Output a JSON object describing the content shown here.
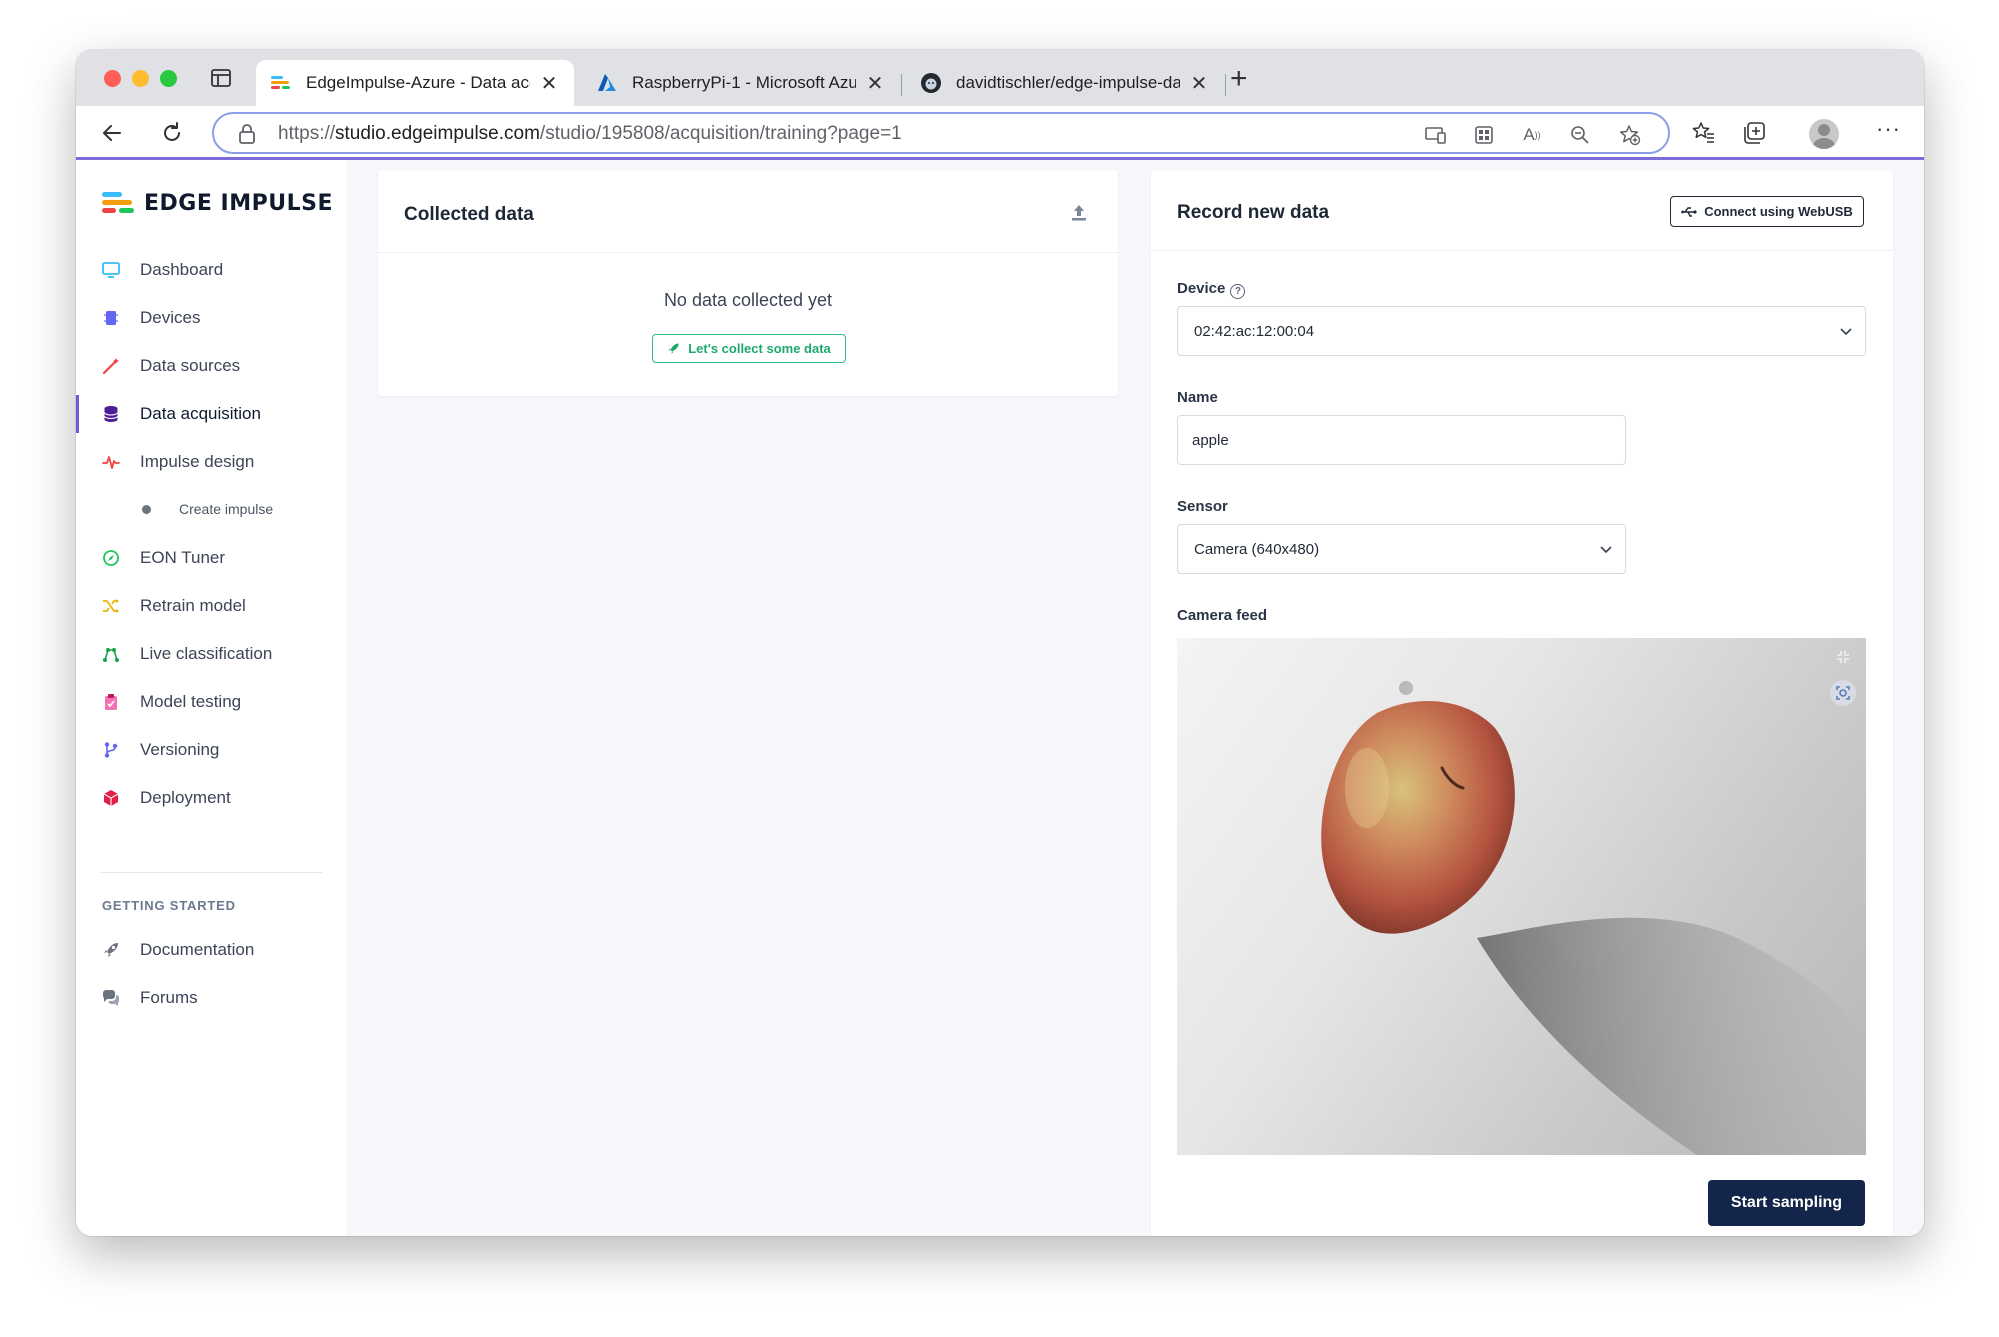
{
  "browser": {
    "tabs": [
      {
        "title": "EdgeImpulse-Azure - Data acq",
        "icon": "edge-impulse-favicon",
        "active": true
      },
      {
        "title": "RaspberryPi-1 - Microsoft Azur",
        "icon": "azure-favicon",
        "active": false
      },
      {
        "title": "davidtischler/edge-impulse-da",
        "icon": "github-favicon",
        "active": false
      }
    ],
    "url_scheme": "https://",
    "url_host": "studio.edgeimpulse.com",
    "url_path": "/studio/195808/acquisition/training?page=1"
  },
  "sidebar": {
    "logo": "EDGE IMPULSE",
    "items": [
      {
        "label": "Dashboard",
        "icon": "monitor-icon",
        "color": "#38bdf8"
      },
      {
        "label": "Devices",
        "icon": "chip-icon",
        "color": "#6366f1"
      },
      {
        "label": "Data sources",
        "icon": "wand-icon",
        "color": "#ef4444"
      },
      {
        "label": "Data acquisition",
        "icon": "database-icon",
        "color": "#4c1d95"
      },
      {
        "label": "Impulse design",
        "icon": "pulse-icon",
        "color": "#ef4444"
      },
      {
        "label": "Create impulse",
        "icon": "dot-icon",
        "color": "#6b7280"
      },
      {
        "label": "EON Tuner",
        "icon": "compass-icon",
        "color": "#22c55e"
      },
      {
        "label": "Retrain model",
        "icon": "shuffle-icon",
        "color": "#eab308"
      },
      {
        "label": "Live classification",
        "icon": "graph-icon",
        "color": "#16a34a"
      },
      {
        "label": "Model testing",
        "icon": "clipboard-icon",
        "color": "#f472b6"
      },
      {
        "label": "Versioning",
        "icon": "branch-icon",
        "color": "#6366f1"
      },
      {
        "label": "Deployment",
        "icon": "cube-icon",
        "color": "#e11d48"
      }
    ],
    "section_heading": "GETTING STARTED",
    "getting_started": [
      {
        "label": "Documentation",
        "icon": "rocket-icon"
      },
      {
        "label": "Forums",
        "icon": "chat-icon"
      }
    ]
  },
  "collected": {
    "title": "Collected data",
    "empty_text": "No data collected yet",
    "cta": "Let's collect some data"
  },
  "record": {
    "title": "Record new data",
    "webusb": "Connect using WebUSB",
    "device_label": "Device",
    "device_value": "02:42:ac:12:00:04",
    "name_label": "Name",
    "name_value": "apple",
    "sensor_label": "Sensor",
    "sensor_value": "Camera (640x480)",
    "camera_label": "Camera feed",
    "start": "Start sampling"
  },
  "colors": {
    "accent": "#6d5bd0",
    "primary_button": "#13254a",
    "success": "#2fbd7e"
  }
}
